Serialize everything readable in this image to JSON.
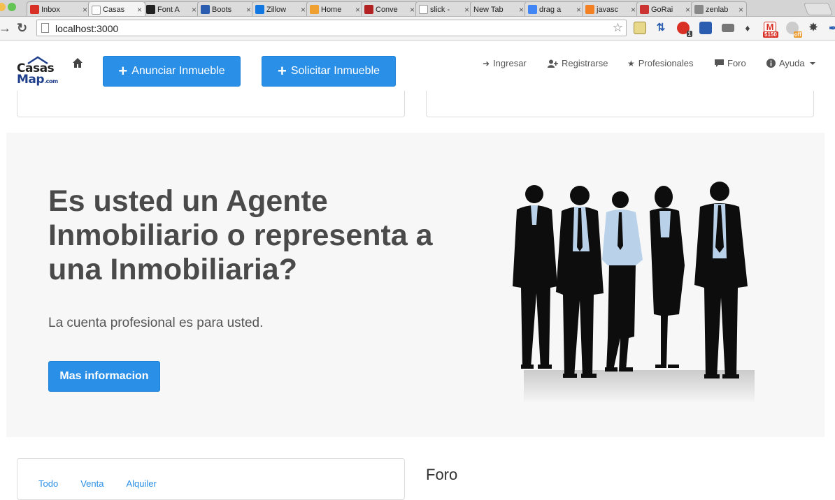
{
  "browser": {
    "tabs": [
      {
        "label": "Inbox",
        "favicon": "gmail-icon",
        "color": "#d93025"
      },
      {
        "label": "Casas",
        "favicon": "page-icon",
        "color": "#ffffff",
        "active": true
      },
      {
        "label": "Font A",
        "favicon": "flag-icon",
        "color": "#222222"
      },
      {
        "label": "Boots",
        "favicon": "bootsnipp-icon",
        "color": "#2a5db0"
      },
      {
        "label": "Zillow",
        "favicon": "zillow-icon",
        "color": "#1277e1"
      },
      {
        "label": "Home",
        "favicon": "home-icon",
        "color": "#f0a030"
      },
      {
        "label": "Conve",
        "favicon": "html-icon",
        "color": "#b22222"
      },
      {
        "label": "slick -",
        "favicon": "page-icon",
        "color": "#ffffff"
      },
      {
        "label": "New Tab",
        "favicon": "",
        "color": ""
      },
      {
        "label": "drag a",
        "favicon": "google-icon",
        "color": "#4285f4"
      },
      {
        "label": "javasc",
        "favicon": "stackoverflow-icon",
        "color": "#f48024"
      },
      {
        "label": "GoRai",
        "favicon": "gorails-icon",
        "color": "#cc3333"
      },
      {
        "label": "zenlab",
        "favicon": "zenlab-icon",
        "color": "#888888"
      }
    ],
    "url": "localhost:3000",
    "extensions": {
      "gmail_count": "5150",
      "badge_count": "1",
      "off_label": "off"
    }
  },
  "navbar": {
    "logo_line1": "Casas",
    "logo_line2": "Map",
    "logo_suffix": ".com",
    "btn_anunciar": "Anunciar Inmueble",
    "btn_solicitar": "Solicitar Inmueble",
    "links": {
      "ingresar": "Ingresar",
      "registrarse": "Registrarse",
      "profesionales": "Profesionales",
      "foro": "Foro",
      "ayuda": "Ayuda"
    }
  },
  "hero": {
    "headline": "Es usted un Agente Inmobiliario o representa a una Inmobiliaria?",
    "subtext": "La cuenta profesional es para usted.",
    "cta": "Mas informacion"
  },
  "bottom": {
    "tabs": [
      "Todo",
      "Venta",
      "Alquiler"
    ],
    "foro_title": "Foro"
  },
  "colors": {
    "accent": "#2a8fe6",
    "hero_bg": "#f7f7f7",
    "heading": "#4a4a4a"
  }
}
